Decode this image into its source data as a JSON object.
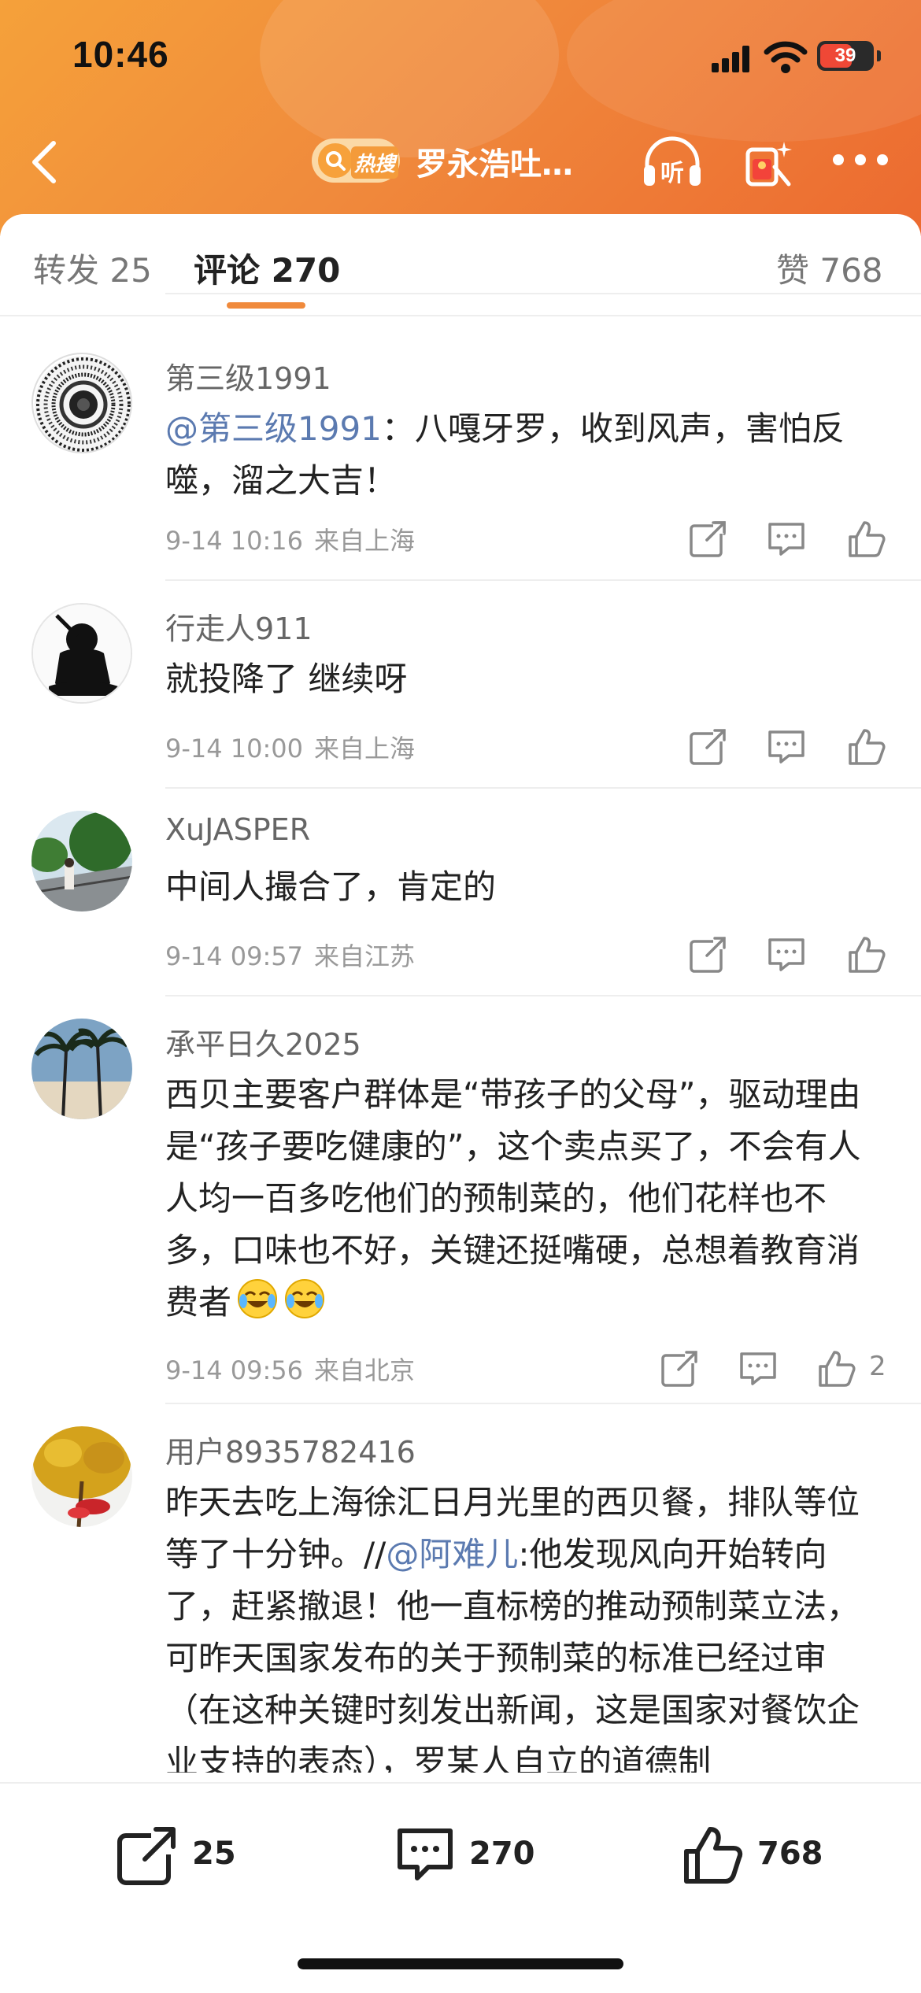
{
  "status": {
    "time": "10:46",
    "battery": "39"
  },
  "nav": {
    "hot_label": "热搜",
    "title": "罗永浩吐…"
  },
  "tabs": [
    {
      "label": "转发 25"
    },
    {
      "label": "评论 270"
    },
    {
      "label": "赞 768"
    }
  ],
  "comments": [
    {
      "user": "第三级1991",
      "mention": "@第三级1991",
      "text": "：八嘎牙罗，收到风声，害怕反噬，溜之大吉！",
      "date": "9-14 10:16",
      "location": "来自上海",
      "likes": ""
    },
    {
      "user": "行走人911",
      "text": "就投降了  继续呀",
      "date": "9-14 10:00",
      "location": "来自上海",
      "likes": ""
    },
    {
      "user": "XuJASPER",
      "text": "中间人撮合了，肯定的",
      "date": "9-14 09:57",
      "location": "来自江苏",
      "likes": ""
    },
    {
      "user": "承平日久2025",
      "text": "西贝主要客户群体是“带孩子的父母”，驱动理由是“孩子要吃健康的”，这个卖点买了，不会有人人均一百多吃他们的预制菜的，他们花样也不多，口味也不好，关键还挺嘴硬，总想着教育消费者",
      "date": "9-14 09:56",
      "location": "来自北京",
      "likes": "2"
    },
    {
      "user": "用户8935782416",
      "text_before": "昨天去吃上海徐汇日月光里的西贝餐，排队等位等了十分钟。//",
      "mention": "@阿难儿",
      "text_after": ":他发现风向开始转向了，赶紧撤退！他一直标榜的推动预制菜立法，可昨天国家发布的关于预制菜的标准已经过审（在这种关键时刻发出新闻，这是国家对餐饮企业支持的表态），罗某人自立的道德制"
    }
  ],
  "bottom": {
    "repost_count": "25",
    "comment_count": "270",
    "like_count": "768"
  },
  "colors": {
    "accent": "#f08a3c",
    "mention": "#5b7ab0"
  }
}
